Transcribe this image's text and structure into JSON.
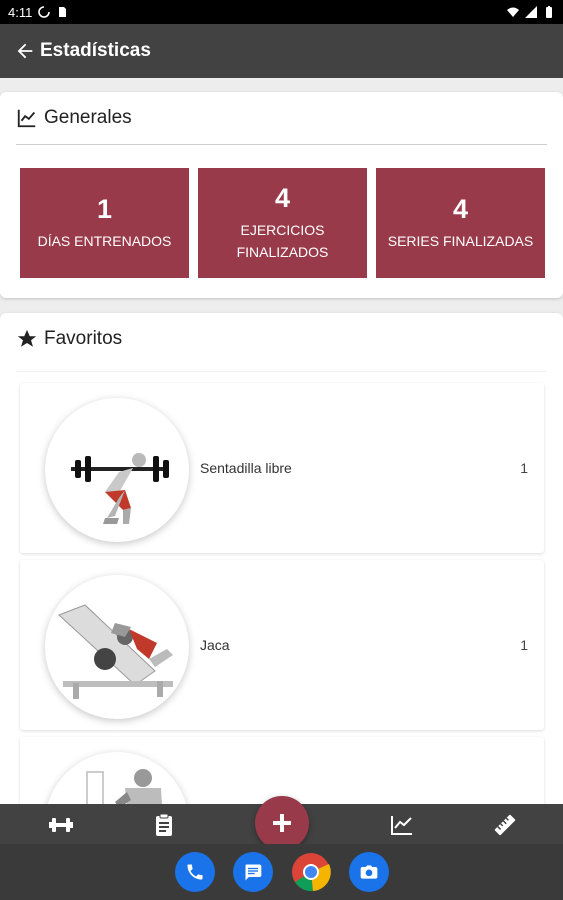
{
  "status_bar": {
    "time": "4:11"
  },
  "app_bar": {
    "title": "Estadísticas"
  },
  "general": {
    "title": "Generales",
    "stats": [
      {
        "value": "1",
        "label": "DÍAS ENTRENADOS"
      },
      {
        "value": "4",
        "label": "EJERCICIOS FINALIZADOS"
      },
      {
        "value": "4",
        "label": "SERIES FINALIZADAS"
      }
    ]
  },
  "favorites": {
    "title": "Favoritos",
    "items": [
      {
        "name": "Sentadilla libre",
        "count": "1"
      },
      {
        "name": "Jaca",
        "count": "1"
      },
      {
        "name": "",
        "count": ""
      }
    ]
  },
  "colors": {
    "accent": "#993a4a",
    "app_bar": "#424242",
    "status_bar": "#000000"
  },
  "bottom_nav": {
    "icons": [
      "dumbbell-icon",
      "clipboard-icon",
      "plus-icon",
      "chart-icon",
      "ruler-icon"
    ]
  },
  "dock": {
    "apps": [
      "phone-icon",
      "messages-icon",
      "chrome-icon",
      "camera-icon"
    ]
  }
}
